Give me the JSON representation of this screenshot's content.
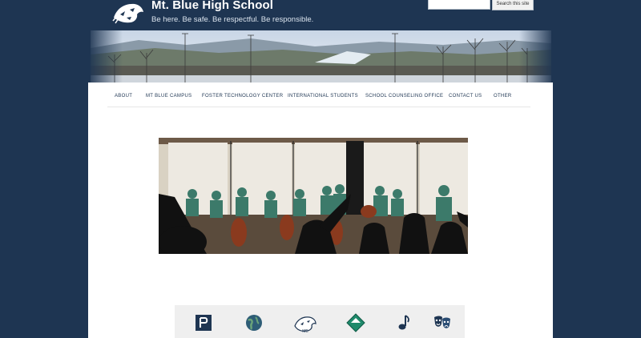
{
  "site": {
    "title": "Mt. Blue High School",
    "tagline": "Be here. Be safe. Be respectful. Be responsible."
  },
  "search": {
    "placeholder": "",
    "button_label": "Search this site"
  },
  "nav": {
    "items": [
      {
        "label": "About"
      },
      {
        "label": "Mt Blue Campus"
      },
      {
        "label": "Foster Technology Center"
      },
      {
        "label": "International Students"
      },
      {
        "label": "School Counseling Office"
      },
      {
        "label": "Contact Us"
      },
      {
        "label": "Other"
      }
    ]
  },
  "quick_links": {
    "icons": [
      {
        "name": "powerschool-icon"
      },
      {
        "name": "globe-icon"
      },
      {
        "name": "cougar-mascot-icon"
      },
      {
        "name": "diamond-flag-icon"
      },
      {
        "name": "music-note-icon"
      },
      {
        "name": "theater-masks-icon"
      }
    ]
  },
  "colors": {
    "background": "#1e3552",
    "nav_text": "#1e3552",
    "card": "#ffffff",
    "icon_bar": "#efefef",
    "teal": "#1f8a6b"
  }
}
